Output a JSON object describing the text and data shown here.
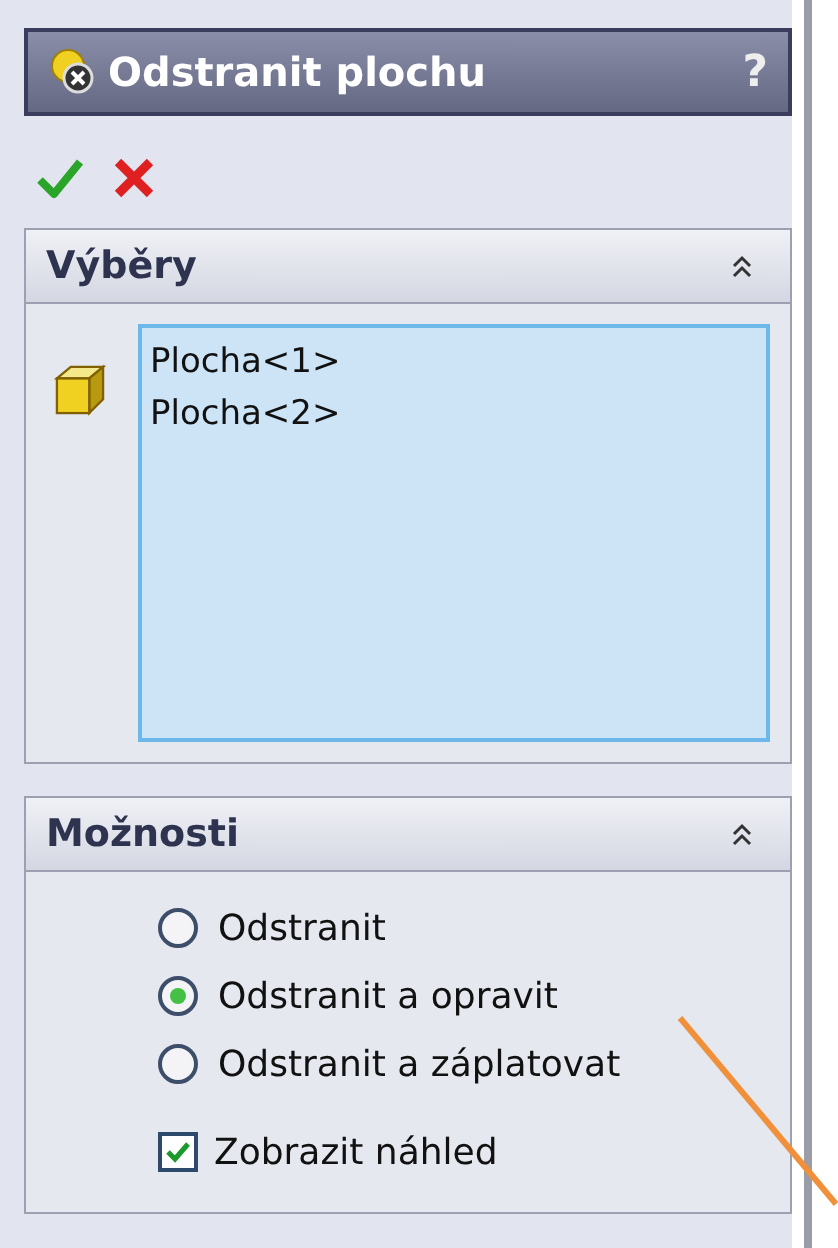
{
  "title": "Odstranit plochu",
  "help": "?",
  "selections": {
    "header": "Výběry",
    "items": [
      "Plocha<1>",
      "Plocha<2>"
    ]
  },
  "options": {
    "header": "Možnosti",
    "radios": [
      {
        "label": "Odstranit",
        "selected": false
      },
      {
        "label": "Odstranit a opravit",
        "selected": true
      },
      {
        "label": "Odstranit a záplatovat",
        "selected": false
      }
    ],
    "preview": {
      "label": "Zobrazit náhled",
      "checked": true
    }
  }
}
